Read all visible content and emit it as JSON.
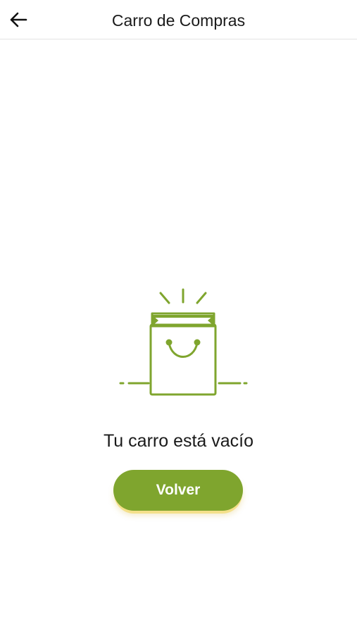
{
  "header": {
    "back_icon": "arrow-left-icon",
    "title": "Carro de Compras"
  },
  "empty_state": {
    "illustration_icon": "smiling-shopping-bag-icon",
    "message": "Tu carro está vacío",
    "button_label": "Volver"
  },
  "colors": {
    "accent": "#7fa52e",
    "button_shadow": "#f4e08a",
    "divider": "#e3e3e3"
  }
}
